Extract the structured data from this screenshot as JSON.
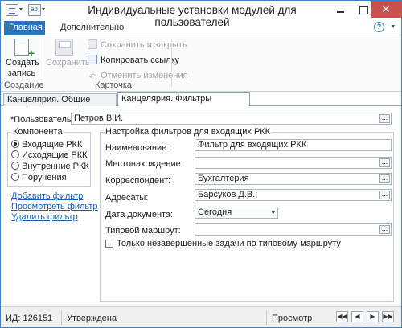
{
  "window": {
    "title": "Индивидуальные установки модулей для пользователей",
    "close_glyph": "✕"
  },
  "ribbon": {
    "tabs": [
      "Главная",
      "Дополнительно"
    ],
    "help_glyph": "?",
    "create": {
      "label_line1": "Создать",
      "label_line2": "запись"
    },
    "save": {
      "label": "Сохранить"
    },
    "save_close": {
      "label": "Сохранить и закрыть"
    },
    "copy_link": {
      "label": "Копировать ссылку"
    },
    "cancel_changes": {
      "label": "Отменить изменения"
    },
    "groups": [
      "Создание",
      "Карточка"
    ]
  },
  "content_tabs": [
    "Канцелярия. Общие настройки",
    "Канцелярия. Фильтры справочников"
  ],
  "form": {
    "user_label": "*Пользователь:",
    "user_value": "Петров В.И.",
    "component_title": "Компонента",
    "components": [
      {
        "label": "Входящие РКК",
        "selected": true
      },
      {
        "label": "Исходящие РКК",
        "selected": false
      },
      {
        "label": "Внутренние РКК",
        "selected": false
      },
      {
        "label": "Поручения",
        "selected": false
      }
    ],
    "links": [
      "Добавить фильтр",
      "Просмотреть фильтр",
      "Удалить фильтр"
    ],
    "filters_title": "Настройка фильтров для входящих РКК",
    "fields": {
      "name_label": "Наименование:",
      "name_value": "Фильтр для входящих РКК",
      "location_label": "Местонахождение:",
      "location_value": "",
      "correspondent_label": "Корреспондент:",
      "correspondent_value": "Бухгалтерия",
      "addressees_label": "Адресаты:",
      "addressees_value": "Барсуков Д.В.;",
      "doc_date_label": "Дата документа:",
      "doc_date_value": "Сегодня",
      "route_label": "Типовой маршрут:",
      "route_value": ""
    },
    "only_unfinished_label": "Только незавершенные задачи по типовому маршруту",
    "only_unfinished_checked": false
  },
  "status": {
    "id_text": "ИД: 126151",
    "state": "Утверждена",
    "mode": "Просмотр"
  },
  "glyphs": {
    "dots": "...",
    "chevron": "▾",
    "first": "◀◀",
    "prev": "◀",
    "next": "▶",
    "last": "▶▶"
  }
}
